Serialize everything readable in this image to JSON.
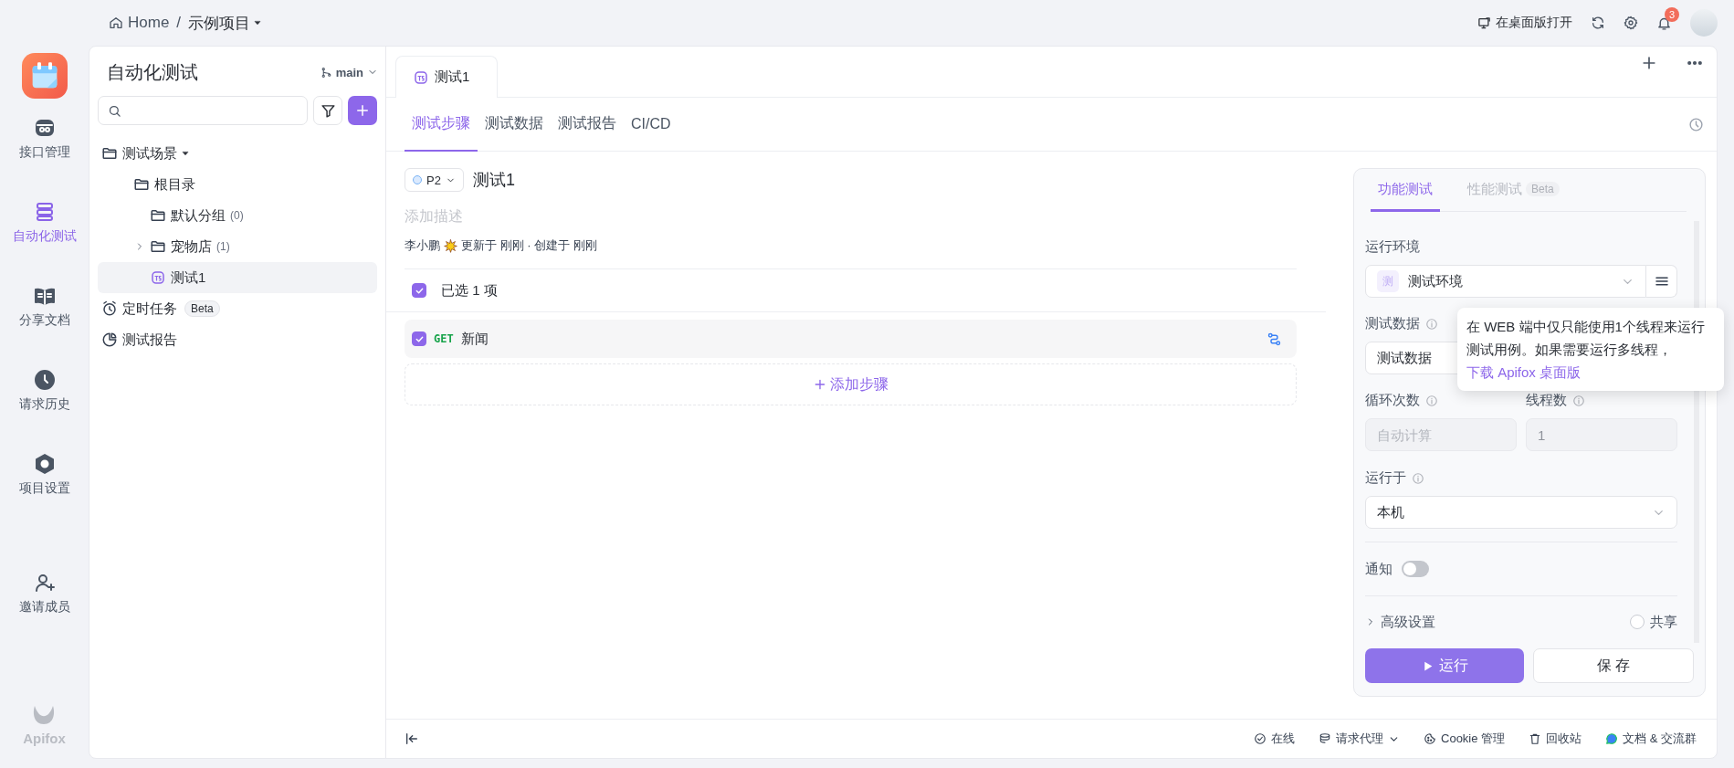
{
  "breadcrumb": {
    "home": "Home",
    "separator": "/",
    "project": "示例项目"
  },
  "top_actions": {
    "open_desktop": "在桌面版打开",
    "notification_count": "3"
  },
  "nav": {
    "items": [
      {
        "label": "接口管理",
        "kind": "api",
        "selected": false
      },
      {
        "label": "自动化测试",
        "kind": "automation",
        "selected": true
      },
      {
        "label": "分享文档",
        "kind": "docs",
        "selected": false
      },
      {
        "label": "请求历史",
        "kind": "history",
        "selected": false
      },
      {
        "label": "项目设置",
        "kind": "settings",
        "selected": false
      }
    ],
    "invite": "邀请成员",
    "brand": "Apifox"
  },
  "tree": {
    "title": "自动化测试",
    "branch": "main",
    "sections": [
      {
        "label": "测试场景",
        "kind": "scenarios",
        "children": [
          {
            "label": "根目录",
            "kind": "folder",
            "expanded": true,
            "selected": false,
            "children": [
              {
                "label": "默认分组",
                "count": "(0)",
                "kind": "folder",
                "expanded": true,
                "selected": false
              },
              {
                "label": "宠物店",
                "count": "(1)",
                "kind": "folder",
                "expanded": false,
                "selected": false
              },
              {
                "label": "测试1",
                "kind": "case",
                "selected": true
              }
            ]
          }
        ]
      },
      {
        "label": "定时任务",
        "kind": "schedule",
        "badge": "Beta"
      },
      {
        "label": "测试报告",
        "kind": "report"
      }
    ]
  },
  "doc_tabs": [
    {
      "label": "测试1",
      "selected": true
    }
  ],
  "sub_tabs": [
    {
      "label": "测试步骤",
      "selected": true
    },
    {
      "label": "测试数据",
      "selected": false
    },
    {
      "label": "测试报告",
      "selected": false
    },
    {
      "label": "CI/CD",
      "selected": false
    }
  ],
  "scenario": {
    "priority": "P2",
    "title": "测试1",
    "description_placeholder": "添加描述",
    "author": "李小鹏",
    "meta": "更新于 刚刚 · 创建于 刚刚"
  },
  "selection": {
    "checked": true,
    "label": "已选 1 项"
  },
  "steps": [
    {
      "checked": true,
      "method": "GET",
      "name": "新闻"
    }
  ],
  "add_step": "添加步骤",
  "run_panel": {
    "tabs": [
      {
        "label": "功能测试",
        "selected": true
      },
      {
        "label": "性能测试",
        "selected": false,
        "badge": "Beta"
      }
    ],
    "env_label": "运行环境",
    "env_badge": "测",
    "env_value": "测试环境",
    "data_label": "测试数据",
    "data_value": "测试数据",
    "loop_label": "循环次数",
    "loop_placeholder": "自动计算",
    "loop_disabled": true,
    "threads_label": "线程数",
    "threads_value": "1",
    "threads_disabled": true,
    "run_on_label": "运行于",
    "run_on_value": "本机",
    "notify_label": "通知",
    "notify_on": false,
    "advanced_label": "高级设置",
    "share_label": "共享",
    "share_checked": false,
    "run_button": "运行",
    "save_button": "保 存",
    "tooltip": {
      "text": "在 WEB 端中仅只能使用1个线程来运行测试用例。如果需要运行多线程，",
      "link": "下载 Apifox 桌面版"
    }
  },
  "status_bar": {
    "items": [
      {
        "label": "在线",
        "kind": "online"
      },
      {
        "label": "请求代理",
        "kind": "proxy"
      },
      {
        "label": "Cookie 管理",
        "kind": "cookie"
      },
      {
        "label": "回收站",
        "kind": "trash"
      },
      {
        "label": "文档 & 交流群",
        "kind": "community"
      }
    ]
  }
}
